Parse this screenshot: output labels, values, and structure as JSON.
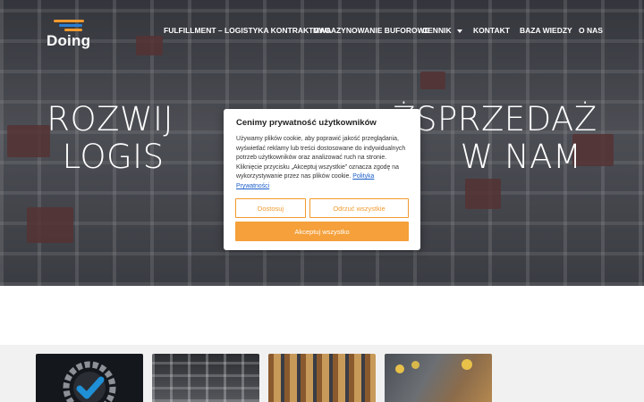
{
  "header": {
    "logo_text": "Doing",
    "nav": [
      {
        "label": "FULFILLMENT – LOGISTYKA KONTRAKTOWA"
      },
      {
        "label": "MAGAZYNOWANIE BUFOROWE"
      },
      {
        "label": "CENNIK"
      },
      {
        "label": "KONTAKT"
      },
      {
        "label": "BAZA WIEDZY"
      },
      {
        "label": "O NAS"
      }
    ]
  },
  "hero": {
    "line1": "ROZWIJ                    ŻSPRZEDAŻ",
    "line2": "LOGIS                           W NAM"
  },
  "cookie": {
    "title": "Cenimy prywatność użytkowników",
    "text": "Używamy plików cookie, aby poprawić jakość przeglądania, wyświetlać reklamy lub treści dostosowane do indywidualnych potrzeb użytkowników oraz analizować ruch na stronie. Kliknięcie przycisku „Akceptuj wszystkie” oznacza zgodę na wykorzystywanie przez nas plików cookie.",
    "link": "Polityka Prywatności",
    "customize": "Dostosuj",
    "reject": "Odrzuć wszystkie",
    "accept": "Akceptuj wszystko"
  },
  "colors": {
    "accent": "#f5a03a",
    "link": "#1a5ec9",
    "logo_blue": "#2c7fd1"
  }
}
